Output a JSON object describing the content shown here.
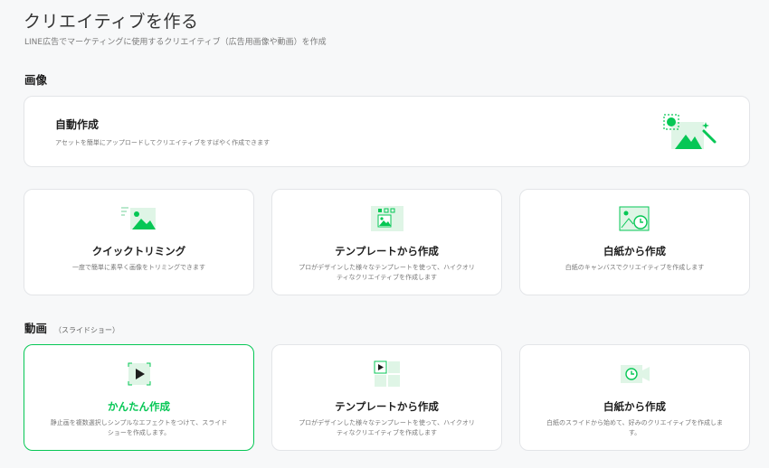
{
  "header": {
    "title": "クリエイティブを作る",
    "subtitle": "LINE広告でマーケティングに使用するクリエイティブ（広告用画像や動画）を作成"
  },
  "sections": {
    "image": {
      "heading": "画像"
    },
    "video": {
      "heading": "動画",
      "subheading": "（スライドショー）"
    }
  },
  "auto_create": {
    "title": "自動作成",
    "description": "アセットを簡単にアップロードしてクリエイティブをすばやく作成できます",
    "icon": "magic-image-icon"
  },
  "image_cards": [
    {
      "title": "クイックトリミング",
      "description": "一度で簡単に素早く画像をトリミングできます",
      "icon": "crop-image-icon"
    },
    {
      "title": "テンプレートから作成",
      "description": "プロがデザインした様々なテンプレートを使って、ハイクオリティなクリエイティブを作成します",
      "icon": "template-image-icon"
    },
    {
      "title": "白紙から作成",
      "description": "白紙のキャンバスでクリエイティブを作成します",
      "icon": "blank-canvas-icon"
    }
  ],
  "video_cards": [
    {
      "title": "かんたん作成",
      "description": "静止画を複数選択しシンプルなエフェクトをつけて、スライドショーを作成します。",
      "icon": "play-video-icon",
      "selected": true
    },
    {
      "title": "テンプレートから作成",
      "description": "プロがデザインした様々なテンプレートを使って、ハイクオリティなクリエイティブを作成します",
      "icon": "template-video-icon"
    },
    {
      "title": "白紙から作成",
      "description": "白紙のスライドから始めて、好みのクリエイティブを作成します。",
      "icon": "blank-video-icon"
    }
  ],
  "colors": {
    "accent": "#06c755",
    "accent_light": "#dff5e6"
  }
}
